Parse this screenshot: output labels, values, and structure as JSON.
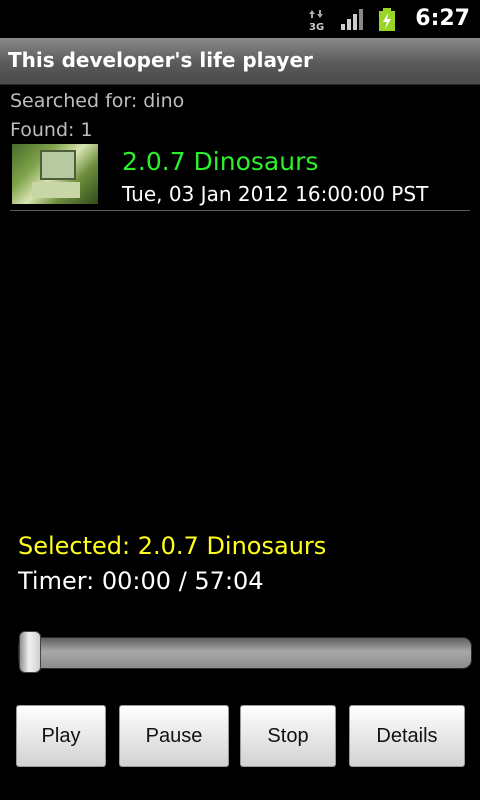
{
  "status_bar": {
    "time": "6:27",
    "network": "3G",
    "icons": [
      "network-3g-icon",
      "signal-icon",
      "battery-charging-icon"
    ]
  },
  "app": {
    "title": "This developer's life player"
  },
  "search": {
    "label": "Searched for: dino",
    "found": "Found: 1"
  },
  "results": [
    {
      "title": "2.0.7 Dinosaurs",
      "date": "Tue, 03 Jan 2012 16:00:00 PST"
    }
  ],
  "player": {
    "selected": "Selected: 2.0.7 Dinosaurs",
    "timer": "Timer: 00:00 / 57:04",
    "progress_fraction": 0
  },
  "buttons": {
    "play": "Play",
    "pause": "Pause",
    "stop": "Stop",
    "details": "Details"
  },
  "colors": {
    "result_title": "#2df02d",
    "selected_text": "#ffff1a",
    "background": "#000000"
  }
}
